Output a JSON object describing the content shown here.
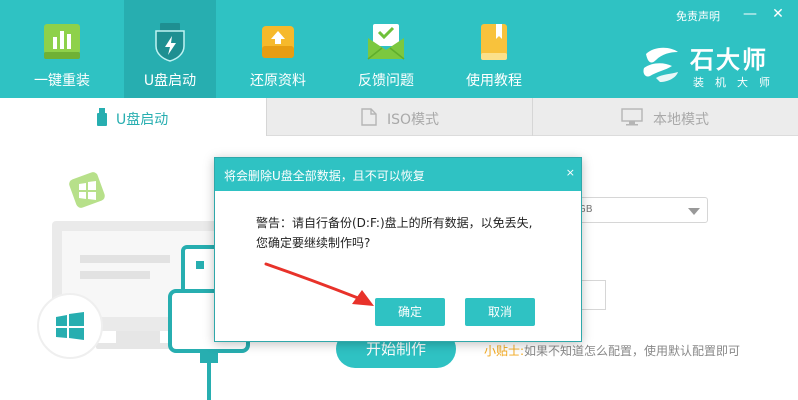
{
  "window": {
    "disclaimer": "免责声明",
    "minimize_symbol": "—",
    "close_symbol": "✕"
  },
  "nav": {
    "items": [
      {
        "label": "一键重装",
        "icon": "chart-icon"
      },
      {
        "label": "U盘启动",
        "icon": "usb-shield-icon",
        "active": true
      },
      {
        "label": "还原资料",
        "icon": "restore-icon"
      },
      {
        "label": "反馈问题",
        "icon": "mail-icon"
      },
      {
        "label": "使用教程",
        "icon": "book-icon"
      }
    ]
  },
  "brand": {
    "name": "石大师",
    "subtitle": "装机大师"
  },
  "tabs": [
    {
      "label": "U盘启动",
      "icon": "usb-icon",
      "active": true
    },
    {
      "label": "ISO模式",
      "icon": "file-icon"
    },
    {
      "label": "本地模式",
      "icon": "monitor-icon"
    }
  ],
  "background": {
    "select_value": "GB",
    "start_button": "开始制作",
    "tip_label": "小贴士:",
    "tip_text": "如果不知道怎么配置，使用默认配置即可"
  },
  "dialog": {
    "title": "将会删除U盘全部数据，且不可以恢复",
    "close": "×",
    "message_line1": "警告：请自行备份(D:F:)盘上的所有数据，以免丢失,",
    "message_line2": "您确定要继续制作吗?",
    "confirm": "确定",
    "cancel": "取消"
  },
  "colors": {
    "brand": "#2fc2c3",
    "active_nav": "#27aeb0",
    "annotation_arrow": "#e8322a",
    "tip_label": "#f2a81d"
  }
}
